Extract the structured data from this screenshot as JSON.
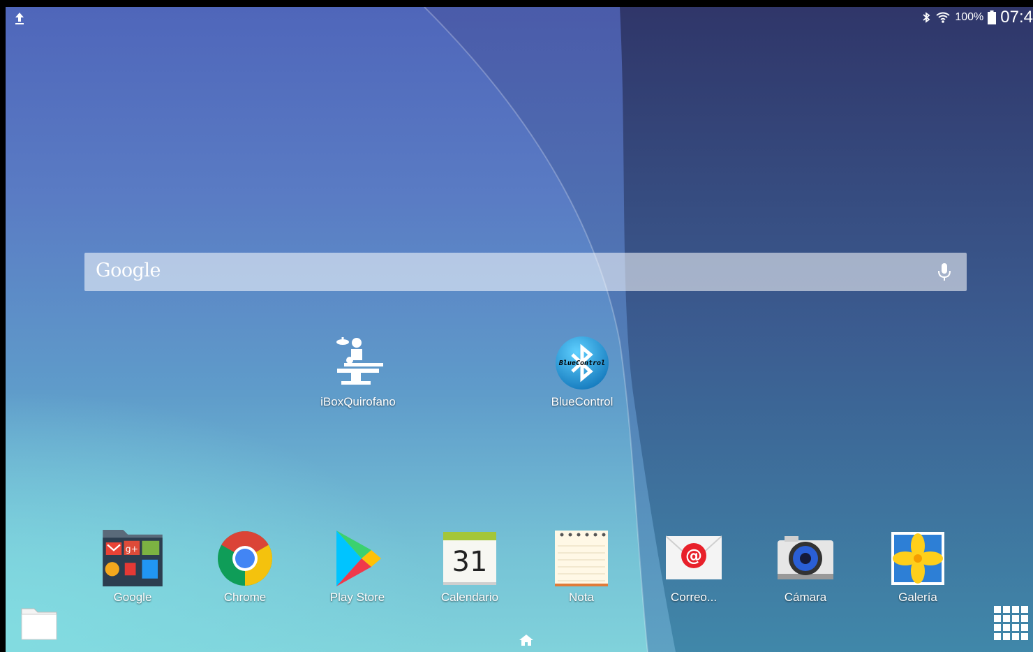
{
  "status_bar": {
    "battery_percent": "100%",
    "time": "07:4",
    "left_icon": "upload-icon",
    "icons": [
      "bluetooth-icon",
      "wifi-icon",
      "battery-icon"
    ]
  },
  "search": {
    "logo": "Google",
    "mic_icon": "mic-icon"
  },
  "home_apps": [
    {
      "label": "iBoxQuirofano",
      "icon": "surgery-table-icon"
    },
    {
      "label": "BlueControl",
      "icon": "bluecontrol-icon",
      "icon_text": "BlueControl"
    }
  ],
  "dock": [
    {
      "label": "Google",
      "icon": "google-folder-icon",
      "folder_text": "g+"
    },
    {
      "label": "Chrome",
      "icon": "chrome-icon"
    },
    {
      "label": "Play Store",
      "icon": "play-store-icon"
    },
    {
      "label": "Calendario",
      "icon": "calendar-icon",
      "day": "31"
    },
    {
      "label": "Nota",
      "icon": "notes-icon"
    },
    {
      "label": "Correo...",
      "icon": "email-icon",
      "glyph": "@"
    },
    {
      "label": "Cámara",
      "icon": "camera-icon"
    },
    {
      "label": "Galería",
      "icon": "gallery-icon"
    }
  ],
  "nav": {
    "folder_icon": "folder-icon",
    "home_icon": "home-icon",
    "apps_icon": "apps-grid-icon"
  },
  "colors": {
    "chrome_red": "#db4437",
    "chrome_yellow": "#f4c20d",
    "chrome_green": "#0f9d58",
    "chrome_blue": "#4285f4",
    "email_red": "#e8202a",
    "calendar_green": "#a4c639"
  }
}
